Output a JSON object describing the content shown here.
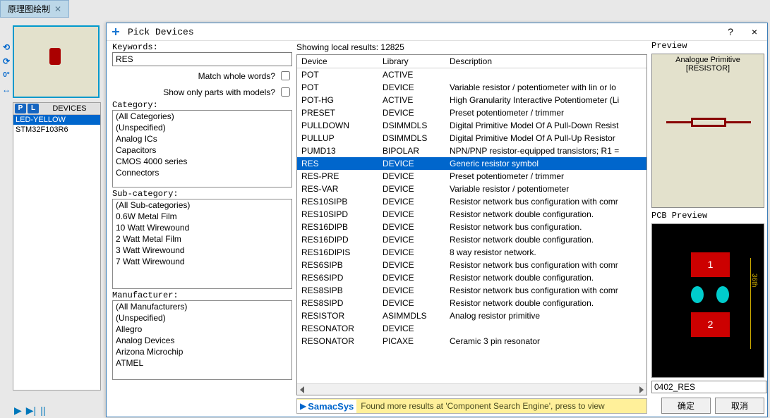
{
  "background": {
    "tab_label": "原理图绘制",
    "devices_title": "DEVICES",
    "device_items": [
      "LED-YELLOW",
      "STM32F103R6"
    ]
  },
  "dialog": {
    "title": "Pick Devices",
    "help": "?",
    "close": "×",
    "keywords_label": "Keywords:",
    "keywords_value": "RES",
    "match_whole_label": "Match whole words?",
    "models_only_label": "Show only parts with models?",
    "category_label": "Category:",
    "categories": [
      "(All Categories)",
      "(Unspecified)",
      "Analog ICs",
      "Capacitors",
      "CMOS 4000 series",
      "Connectors"
    ],
    "subcategory_label": "Sub-category:",
    "subcategories": [
      "(All Sub-categories)",
      "0.6W Metal Film",
      "10 Watt Wirewound",
      "2 Watt Metal Film",
      "3 Watt Wirewound",
      "7 Watt Wirewound"
    ],
    "manufacturer_label": "Manufacturer:",
    "manufacturers": [
      "(All Manufacturers)",
      "(Unspecified)",
      "Allegro",
      "Analog Devices",
      "Arizona Microchip",
      "ATMEL"
    ],
    "results_header_prefix": "Showing local results: ",
    "results_count": "12825",
    "columns": {
      "device": "Device",
      "library": "Library",
      "description": "Description"
    },
    "rows": [
      {
        "device": "POT",
        "library": "ACTIVE",
        "description": ""
      },
      {
        "device": "POT",
        "library": "DEVICE",
        "description": "Variable resistor / potentiometer with lin or lo"
      },
      {
        "device": "POT-HG",
        "library": "ACTIVE",
        "description": "High Granularity Interactive Potentiometer (Li"
      },
      {
        "device": "PRESET",
        "library": "DEVICE",
        "description": "Preset potentiometer / trimmer"
      },
      {
        "device": "PULLDOWN",
        "library": "DSIMMDLS",
        "description": "Digital Primitive Model Of A Pull-Down Resist"
      },
      {
        "device": "PULLUP",
        "library": "DSIMMDLS",
        "description": "Digital Primitive Model Of A Pull-Up Resistor"
      },
      {
        "device": "PUMD13",
        "library": "BIPOLAR",
        "description": "NPN/PNP resistor-equipped transistors; R1 ="
      },
      {
        "device": "RES",
        "library": "DEVICE",
        "description": "Generic resistor symbol",
        "selected": true
      },
      {
        "device": "RES-PRE",
        "library": "DEVICE",
        "description": "Preset potentiometer / trimmer"
      },
      {
        "device": "RES-VAR",
        "library": "DEVICE",
        "description": "Variable resistor / potentiometer"
      },
      {
        "device": "RES10SIPB",
        "library": "DEVICE",
        "description": "Resistor network bus configuration with comr"
      },
      {
        "device": "RES10SIPD",
        "library": "DEVICE",
        "description": "Resistor network double configuration."
      },
      {
        "device": "RES16DIPB",
        "library": "DEVICE",
        "description": "Resistor network bus configuration."
      },
      {
        "device": "RES16DIPD",
        "library": "DEVICE",
        "description": "Resistor network double configuration."
      },
      {
        "device": "RES16DIPIS",
        "library": "DEVICE",
        "description": "8 way resistor network."
      },
      {
        "device": "RES6SIPB",
        "library": "DEVICE",
        "description": "Resistor network bus configuration with comr"
      },
      {
        "device": "RES6SIPD",
        "library": "DEVICE",
        "description": "Resistor network double configuration."
      },
      {
        "device": "RES8SIPB",
        "library": "DEVICE",
        "description": "Resistor network bus configuration with comr"
      },
      {
        "device": "RES8SIPD",
        "library": "DEVICE",
        "description": "Resistor network double configuration."
      },
      {
        "device": "RESISTOR",
        "library": "ASIMMDLS",
        "description": "Analog resistor primitive"
      },
      {
        "device": "RESONATOR",
        "library": "DEVICE",
        "description": ""
      },
      {
        "device": "RESONATOR",
        "library": "PICAXE",
        "description": "Ceramic 3 pin resonator"
      }
    ],
    "samacsys_brand": "SamacSys",
    "samacsys_msg": "Found more results at 'Component Search Engine', press to view",
    "preview_label": "Preview",
    "preview_desc": "Analogue Primitive [RESISTOR]",
    "pcb_label": "PCB Preview",
    "pcb_pad1": "1",
    "pcb_pad2": "2",
    "pcb_dim": "36th",
    "footprint": "0402_RES",
    "ok_label": "确定",
    "cancel_label": "取消"
  }
}
